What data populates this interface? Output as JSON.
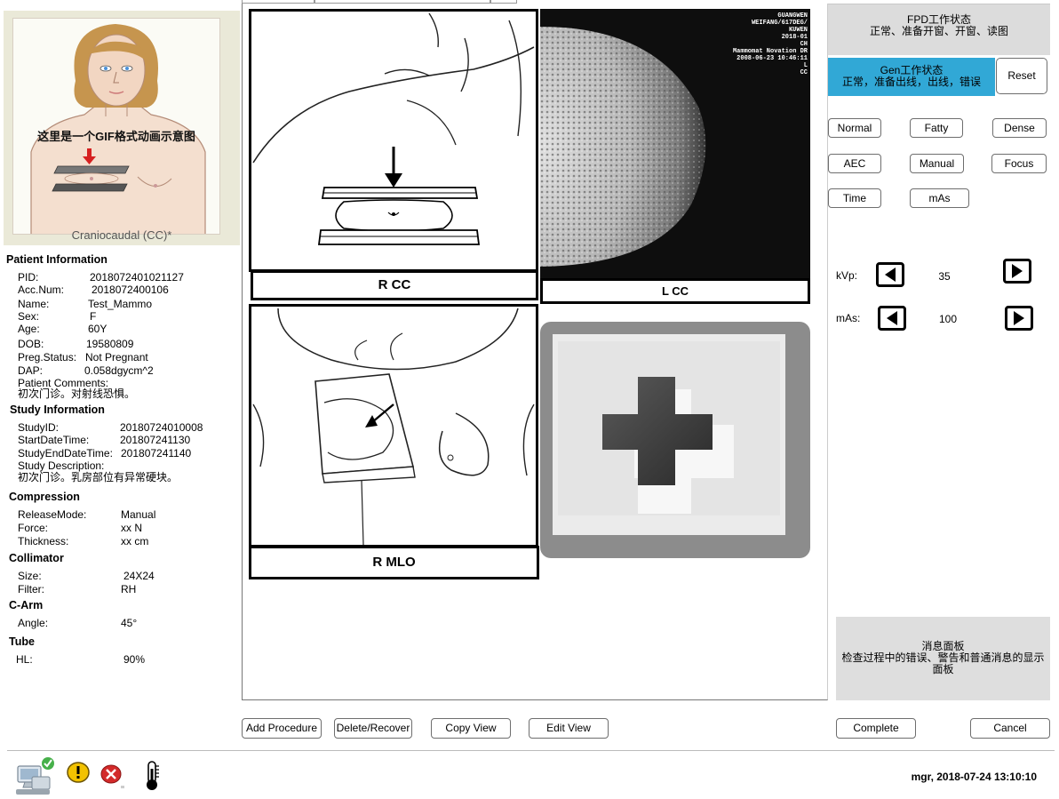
{
  "illustration": {
    "animation_note": "这里是一个GIF格式动画示意图",
    "caption": "Craniocaudal (CC)*"
  },
  "patient": {
    "section_title": "Patient Information",
    "fields": [
      {
        "label": "PID:",
        "value": "2018072401021127"
      },
      {
        "label": "Acc.Num:",
        "value": "2018072400106"
      },
      {
        "label": "Name:",
        "value": "Test_Mammo"
      },
      {
        "label": "Sex:",
        "value": "F"
      },
      {
        "label": "Age:",
        "value": "60Y"
      },
      {
        "label": "DOB:",
        "value": "19580809"
      },
      {
        "label": "Preg.Status:",
        "value": "Not Pregnant"
      },
      {
        "label": "DAP:",
        "value": "0.058dgycm^2"
      }
    ],
    "comments_label": "Patient Comments:",
    "comments": "初次门诊。对射线恐惧。"
  },
  "study": {
    "section_title": "Study Information",
    "fields": [
      {
        "label": "StudyID:",
        "value": "20180724010008"
      },
      {
        "label": "StartDateTime:",
        "value": "201807241130"
      },
      {
        "label": "StudyEndDateTime:",
        "value": "201807241140"
      }
    ],
    "description_label": "Study Description:",
    "description": "初次门诊。乳房部位有异常硬块。"
  },
  "compression": {
    "section_title": "Compression",
    "fields": [
      {
        "label": "ReleaseMode:",
        "value": "Manual"
      },
      {
        "label": "Force:",
        "value": "xx N"
      },
      {
        "label": "Thickness:",
        "value": "xx cm"
      }
    ]
  },
  "collimator": {
    "section_title": "Collimator",
    "fields": [
      {
        "label": "Size:",
        "value": "24X24"
      },
      {
        "label": "Filter:",
        "value": "RH"
      }
    ]
  },
  "carm": {
    "section_title": "C-Arm",
    "fields": [
      {
        "label": "Angle:",
        "value": "45°"
      }
    ]
  },
  "tube": {
    "section_title": "Tube",
    "fields": [
      {
        "label": "HL:",
        "value": "90%"
      }
    ]
  },
  "views": {
    "rcc_label": "R   CC",
    "lcc_label": "L CC",
    "rmlo_label": "R  MLO",
    "xray_overlay": [
      "GUANGWEN",
      "WEIFANG/617DEG/",
      "KUWEN",
      "2018-01",
      "CH",
      "Mammomat Novation DR",
      "2008-06-23 10:46:11",
      "L",
      "CC"
    ]
  },
  "actions": {
    "add_procedure": "Add Procedure",
    "delete_recover": "Delete/Recover",
    "copy_view": "Copy View",
    "edit_view": "Edit View",
    "complete": "Complete",
    "cancel": "Cancel"
  },
  "right_panel": {
    "fpd_title": "FPD工作状态",
    "fpd_states": "正常、准备开窗、开窗、读图",
    "gen_title": "Gen工作状态",
    "gen_states": "正常，准备出线，出线，错误",
    "reset": "Reset",
    "modes": [
      "Normal",
      "Fatty",
      "Dense",
      "AEC",
      "Manual",
      "Focus",
      "Time",
      "mAs"
    ],
    "kvp_label": "kVp:",
    "kvp_value": "35",
    "mas_label": "mAs:",
    "mas_value": "100",
    "message_title": "消息面板",
    "message_text": "检查过程中的错误、警告和普通消息的显示面板",
    "gen_color": "#31a8d6"
  },
  "status_bar": {
    "user_datetime": "mgr,  2018-07-24 13:10:10"
  }
}
